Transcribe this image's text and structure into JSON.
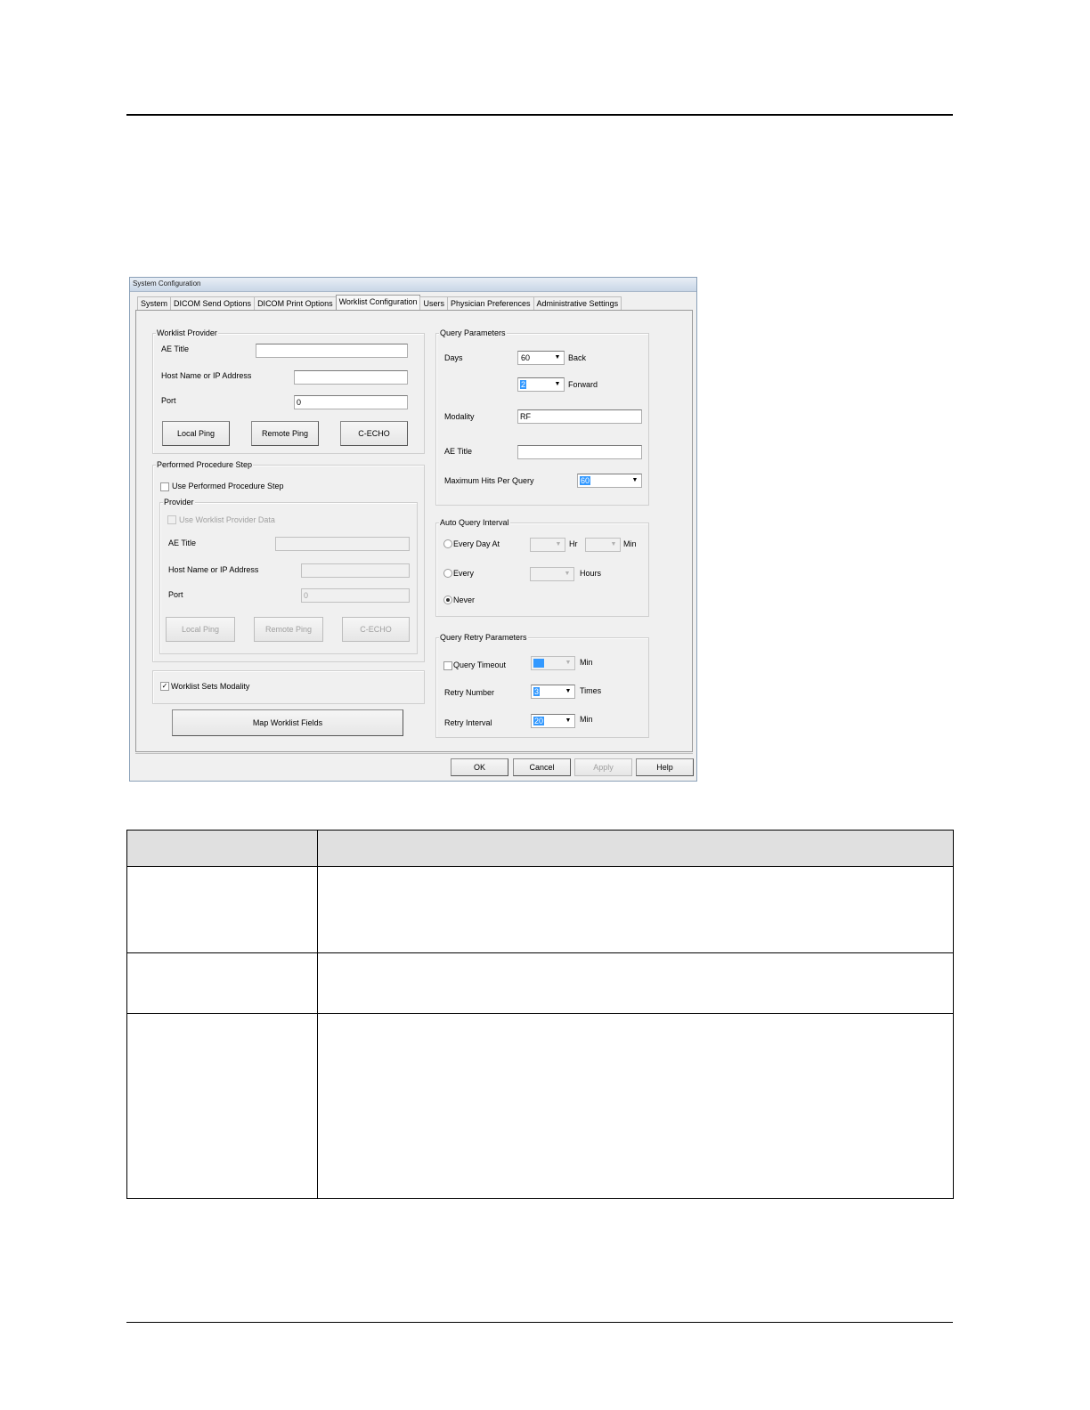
{
  "dialog": {
    "title": "System Configuration",
    "tabs": [
      "System",
      "DICOM Send Options",
      "DICOM Print Options",
      "Worklist Configuration",
      "Users",
      "Physician Preferences",
      "Administrative Settings"
    ],
    "active_tab": "Worklist Configuration",
    "worklist_provider": {
      "group_label": "Worklist Provider",
      "ae_title_label": "AE Title",
      "ae_title_value": "",
      "host_label": "Host Name or IP Address",
      "host_value": "",
      "port_label": "Port",
      "port_value": "0",
      "local_ping": "Local Ping",
      "remote_ping": "Remote Ping",
      "c_echo": "C-ECHO"
    },
    "pps": {
      "group_label": "Performed Procedure Step",
      "use_pps_label": "Use Performed Procedure Step",
      "use_pps_checked": false,
      "provider": {
        "group_label": "Provider",
        "use_worklist_label": "Use Worklist Provider Data",
        "ae_title_label": "AE Title",
        "ae_title_value": "",
        "host_label": "Host Name or IP Address",
        "host_value": "",
        "port_label": "Port",
        "port_value": "0",
        "local_ping": "Local Ping",
        "remote_ping": "Remote Ping",
        "c_echo": "C-ECHO"
      }
    },
    "worklist_sets_modality": {
      "label": "Worklist Sets Modality",
      "checked": true
    },
    "map_fields": "Map Worklist Fields",
    "query_params": {
      "group_label": "Query Parameters",
      "days_label": "Days",
      "days_back_value": "60",
      "back_label": "Back",
      "days_forward_value": "2",
      "forward_label": "Forward",
      "modality_label": "Modality",
      "modality_value": "RF",
      "ae_title_label": "AE Title",
      "ae_title_value": "",
      "max_hits_label": "Maximum Hits Per Query",
      "max_hits_value": "60"
    },
    "auto_query": {
      "group_label": "Auto Query Interval",
      "every_day_label": "Every Day At",
      "hr_label": "Hr",
      "min_label": "Min",
      "every_label": "Every",
      "hours_label": "Hours",
      "never_label": "Never",
      "selected": "Never"
    },
    "retry": {
      "group_label": "Query Retry Parameters",
      "timeout_label": "Query Timeout",
      "timeout_checked": false,
      "timeout_value": "",
      "timeout_unit": "Min",
      "retry_number_label": "Retry Number",
      "retry_number_value": "3",
      "retry_number_unit": "Times",
      "retry_interval_label": "Retry Interval",
      "retry_interval_value": "20",
      "retry_interval_unit": "Min"
    },
    "footer": {
      "ok": "OK",
      "cancel": "Cancel",
      "apply": "Apply",
      "help": "Help"
    }
  },
  "doc_table": {
    "headers": [
      "",
      ""
    ],
    "rows": [
      [
        "",
        ""
      ],
      [
        "",
        ""
      ],
      [
        "",
        ""
      ]
    ]
  }
}
